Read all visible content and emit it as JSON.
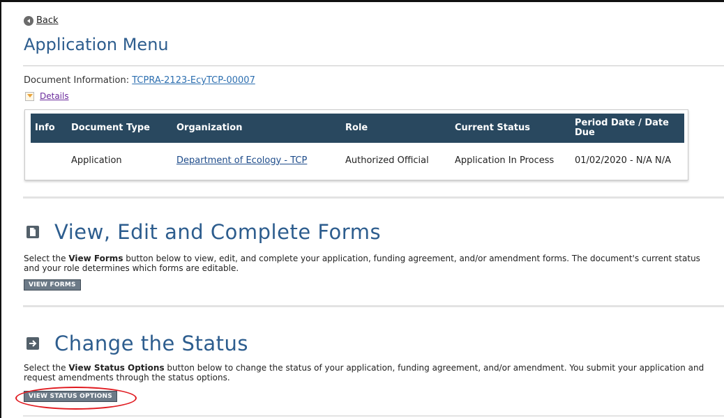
{
  "nav": {
    "back_label": "Back"
  },
  "page": {
    "title": "Application Menu"
  },
  "document_info": {
    "label": "Document Information: ",
    "id_link": "TCPRA-2123-EcyTCP-00007",
    "details_label": "Details"
  },
  "table": {
    "headers": [
      "Info",
      "Document Type",
      "Organization",
      "Role",
      "Current Status",
      "Period Date / Date Due"
    ],
    "rows": [
      {
        "info": "",
        "document_type": "Application",
        "organization": "Department of Ecology - TCP",
        "role": "Authorized Official",
        "current_status": "Application In Process",
        "period_date": "01/02/2020 - N/A N/A"
      }
    ]
  },
  "forms_section": {
    "title": "View, Edit and Complete Forms",
    "text_before": "Select the ",
    "text_bold": "View Forms",
    "text_after": " button below to view, edit, and complete your application, funding agreement, and/or amendment forms. The document's current status and your role determines which forms are editable.",
    "button_label": "VIEW FORMS"
  },
  "status_section": {
    "title": "Change the Status",
    "text_before": "Select the ",
    "text_bold": "View Status Options",
    "text_after": " button below to change the status of your application, funding agreement, and/or amendment. You submit your application and request amendments through the status options.",
    "button_label": "VIEW STATUS OPTIONS"
  },
  "colors": {
    "title_blue": "#2d5d8e",
    "table_header": "#29485f",
    "button_gray": "#6c7a87",
    "annotation_red": "#e0191f"
  },
  "icons": {
    "back": "circle-left-arrow-icon",
    "details": "chevron-down-icon",
    "forms": "document-icon",
    "status": "arrow-right-icon"
  }
}
